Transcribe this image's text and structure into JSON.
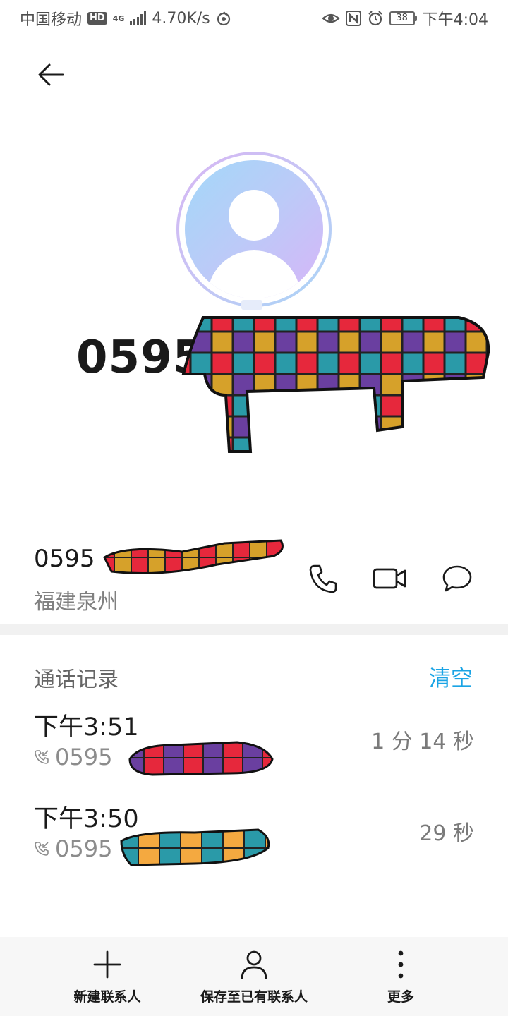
{
  "status_bar": {
    "carrier": "中国移动",
    "hd": "HD",
    "network": "4G",
    "speed": "4.70K/s",
    "battery": "38",
    "time": "下午4:04"
  },
  "contact": {
    "big_number_visible": "0595",
    "number_visible": "0595",
    "location": "福建泉州"
  },
  "call_log": {
    "title": "通话记录",
    "clear_label": "清空",
    "entries": [
      {
        "time": "下午3:51",
        "number_visible": "0595",
        "duration": "1 分 14 秒"
      },
      {
        "time": "下午3:50",
        "number_visible": "0595",
        "duration": "29 秒"
      }
    ]
  },
  "bottom_bar": {
    "new_contact": "新建联系人",
    "save_existing": "保存至已有联系人",
    "more": "更多"
  },
  "colors": {
    "accent": "#1aa4e5",
    "divider": "#f1f1f1"
  }
}
